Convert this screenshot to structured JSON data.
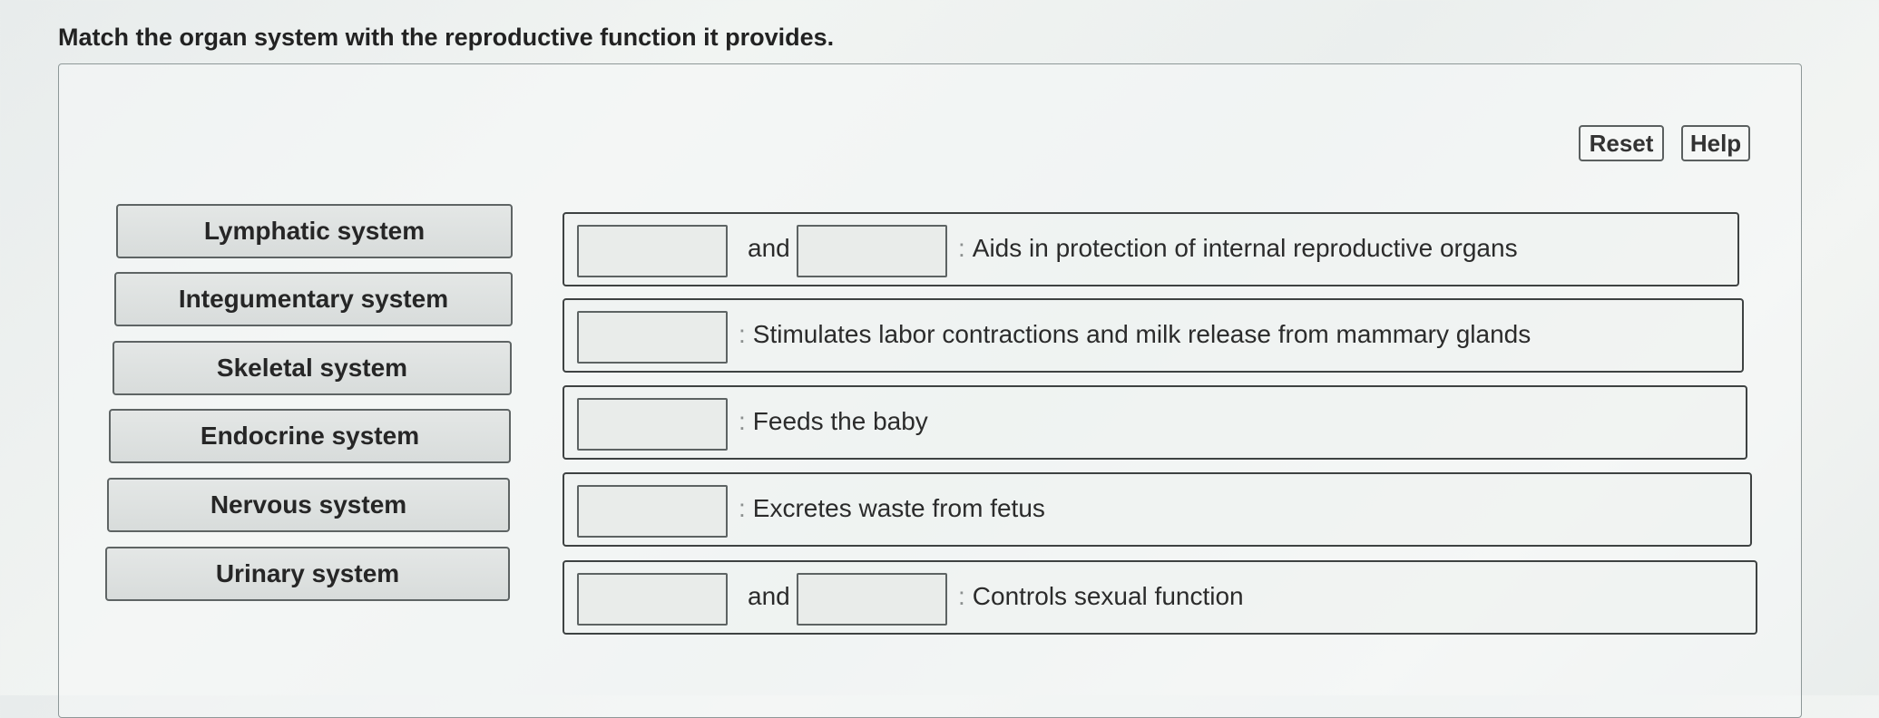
{
  "question": "Match the organ system with the reproductive function it provides.",
  "buttons": {
    "reset": "Reset",
    "help": "Help"
  },
  "terms": [
    "Lymphatic system",
    "Integumentary system",
    "Skeletal system",
    "Endocrine system",
    "Nervous system",
    "Urinary system"
  ],
  "targets": [
    {
      "connector": "and",
      "colon": ":",
      "description": "Aids in protection of internal reproductive organs"
    },
    {
      "colon": ":",
      "description": "Stimulates labor contractions and milk release from mammary glands"
    },
    {
      "colon": ":",
      "description": "Feeds the baby"
    },
    {
      "colon": ":",
      "description": "Excretes waste from fetus"
    },
    {
      "connector": "and",
      "colon": ":",
      "description": "Controls sexual function"
    }
  ]
}
